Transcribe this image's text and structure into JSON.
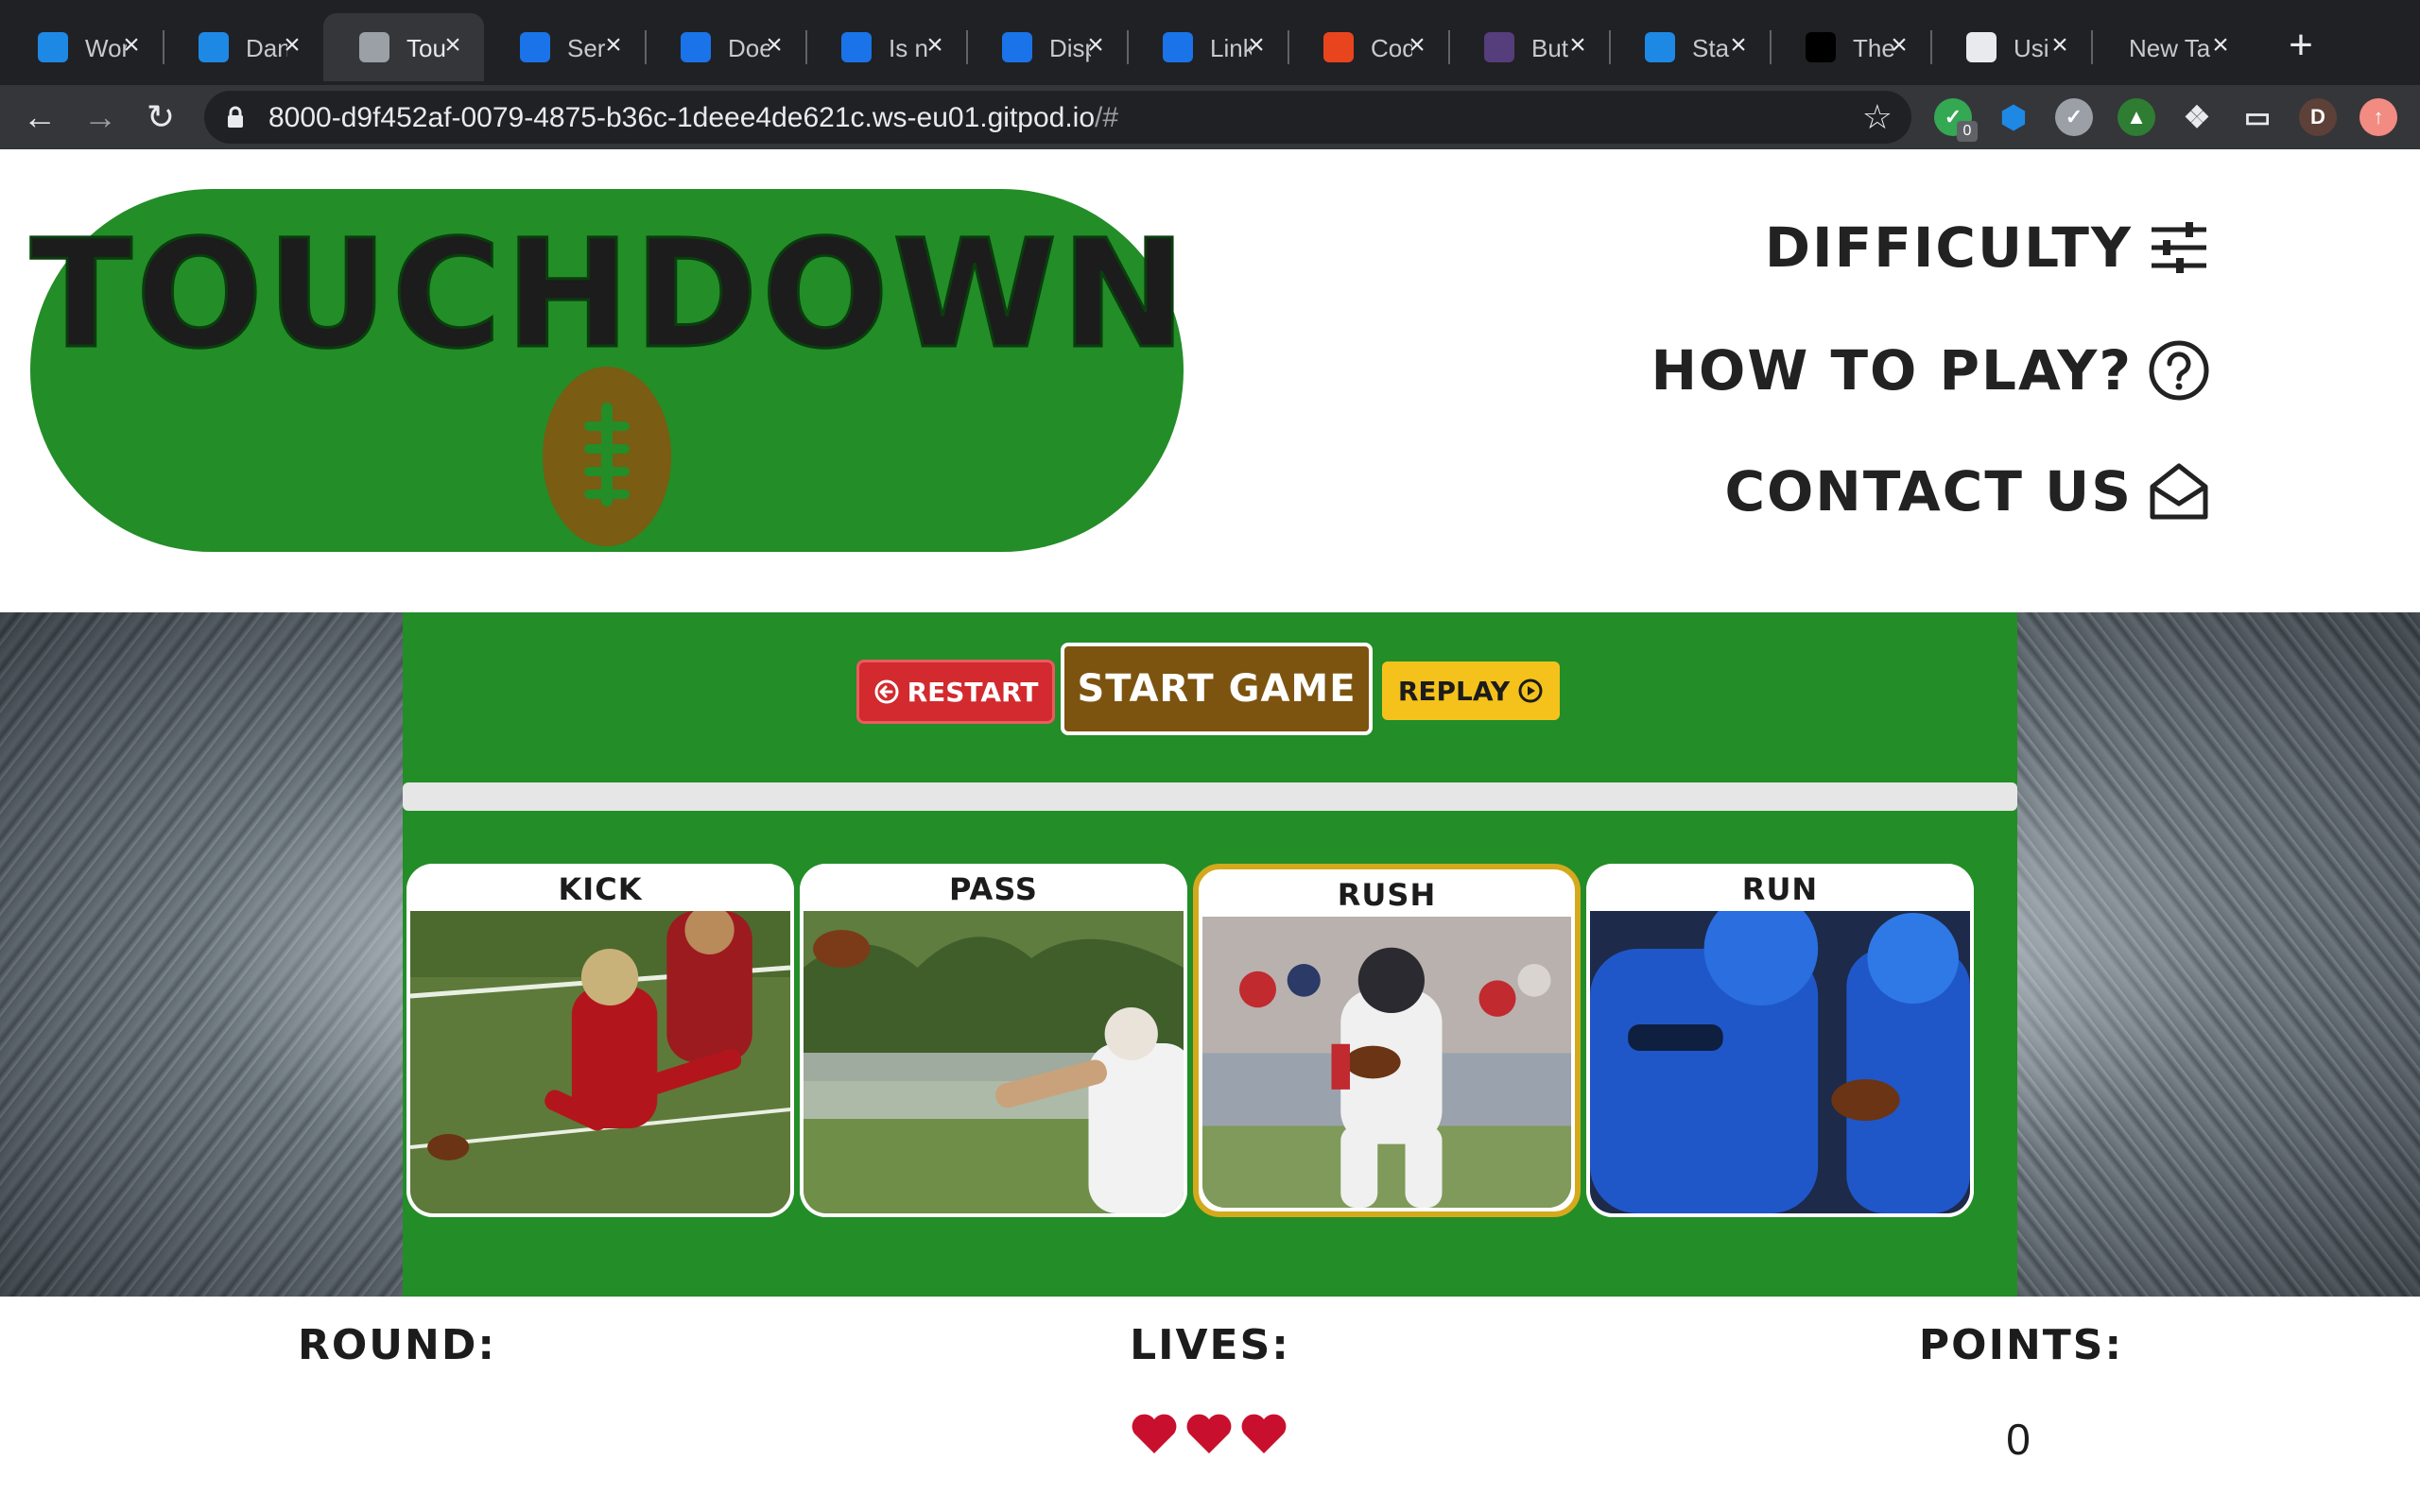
{
  "browser": {
    "tabs": [
      {
        "label": "Wor",
        "icon": "gitpod-icon",
        "color": "#1e88e5"
      },
      {
        "label": "Dan",
        "icon": "gitpod-icon",
        "color": "#1e88e5"
      },
      {
        "label": "Tou",
        "icon": "globe-icon",
        "color": "#9aa0a6",
        "active": true
      },
      {
        "label": "Ser",
        "icon": "powershell-icon",
        "color": "#1a73e8"
      },
      {
        "label": "Doe",
        "icon": "powershell-icon",
        "color": "#1a73e8"
      },
      {
        "label": "Is n",
        "icon": "powershell-icon",
        "color": "#1a73e8"
      },
      {
        "label": "Disp",
        "icon": "powershell-icon",
        "color": "#1a73e8"
      },
      {
        "label": "Link",
        "icon": "powershell-icon",
        "color": "#1a73e8"
      },
      {
        "label": "Cod",
        "icon": "codepen-ring-icon",
        "color": "#e8451e"
      },
      {
        "label": "But",
        "icon": "bootstrap-icon",
        "color": "#563d7c"
      },
      {
        "label": "Sta",
        "icon": "flag-icon",
        "color": "#1e88e5"
      },
      {
        "label": "The",
        "icon": "checker-icon",
        "color": "#000000"
      },
      {
        "label": "Usi",
        "icon": "card-icon",
        "color": "#e8eaed"
      },
      {
        "label": "New Ta",
        "icon": "",
        "color": ""
      }
    ],
    "url_main": "8000-d9f452af-0079-4875-b36c-1deee4de621c.ws-eu01.gitpod.io",
    "url_tail": "/#",
    "extension_badge": "0",
    "profile_initial": "D"
  },
  "header": {
    "logo_title": "TOUCHDOWN",
    "menu": {
      "difficulty": "DIFFICULTY",
      "how_to_play": "HOW TO PLAY?",
      "contact_us": "CONTACT US"
    }
  },
  "game": {
    "buttons": {
      "restart": "RESTART",
      "start": "START GAME",
      "replay": "REPLAY"
    },
    "progress_fraction": 0,
    "cards": [
      {
        "label": "KICK",
        "selected": false
      },
      {
        "label": "PASS",
        "selected": false
      },
      {
        "label": "RUSH",
        "selected": true
      },
      {
        "label": "RUN",
        "selected": false
      }
    ]
  },
  "scoreboard": {
    "round_label": "ROUND:",
    "lives_label": "LIVES:",
    "points_label": "POINTS:",
    "round_value": "",
    "lives_count": 3,
    "points_value": "0"
  },
  "colors": {
    "field_green": "#238d28",
    "restart_red": "#d22a2e",
    "start_brown": "#7c5410",
    "replay_yellow": "#f5c21b",
    "selected_border": "#d4a91c",
    "heart_red": "#c8102e"
  }
}
